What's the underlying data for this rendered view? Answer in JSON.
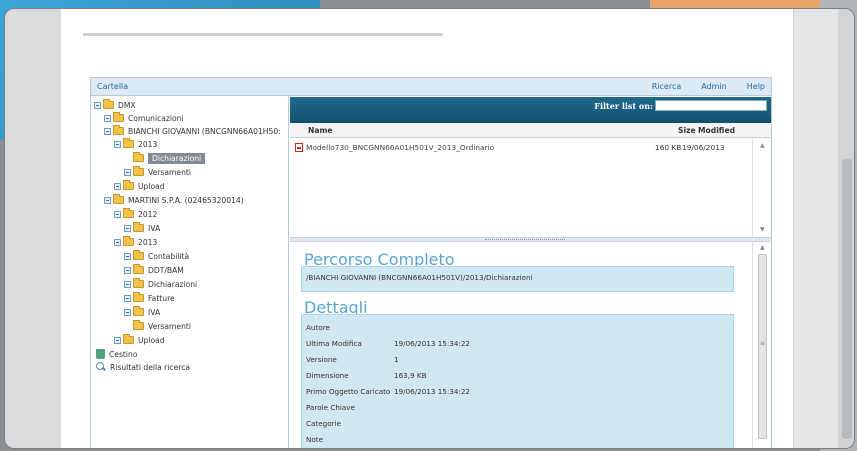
{
  "menubar": {
    "cartella": "Cartella",
    "links": [
      "Ricerca",
      "Admin",
      "Help"
    ]
  },
  "tree": {
    "root": "DMX",
    "comunicazioni": "Comunicazioni",
    "bianchi": "BIANCHI GIOVANNI (BNCGNN66A01H50:",
    "year_2013_a": "2013",
    "dichiarazioni_selected": "Dichiarazioni",
    "versamenti_a": "Versamenti",
    "upload_a": "Upload",
    "martini": "MARTINI S.P.A. (02465320014)",
    "year_2012": "2012",
    "iva_2012": "IVA",
    "year_2013_b": "2013",
    "contabilita": "Contabilità",
    "ddt": "DDT/BAM",
    "dichiarazioni_b": "Dichiarazioni",
    "fatture": "Fatture",
    "iva_2013": "IVA",
    "versamenti_b": "Versamenti",
    "upload_b": "Upload",
    "cestino": "Cestino",
    "risultati": "Risultati della ricerca"
  },
  "list": {
    "filter_label": "Filter list on:",
    "filter_value": "",
    "col_name": "Name",
    "col_size": "Size",
    "col_modified": "Modified",
    "rows": [
      {
        "name": "Modello730_BNCGNN66A01H501V_2013_Ordinario",
        "size": "160 KB",
        "modified": "19/06/2013"
      }
    ]
  },
  "details": {
    "percorso_title": "Percorso Completo",
    "path": "/BIANCHI GIOVANNI (BNCGNN66A01H501V)/2013/Dichiarazioni",
    "dettagli_title": "Dettagli",
    "props": [
      {
        "key": "Autore",
        "value": ""
      },
      {
        "key": "Ultima Modifica",
        "value": "19/06/2013 15:34:22"
      },
      {
        "key": "Versione",
        "value": "1"
      },
      {
        "key": "Dimensione",
        "value": "163,9 KB"
      },
      {
        "key": "Primo Oggetto Caricato",
        "value": "19/06/2013 15:34:22"
      },
      {
        "key": "Parole Chiave",
        "value": ""
      },
      {
        "key": "Categorie",
        "value": ""
      },
      {
        "key": "Note",
        "value": ""
      }
    ]
  },
  "colors": {
    "accent": "#2468a8",
    "header_dark": "#14506d",
    "detail_box": "#cfe8f3",
    "section_title": "#5aa6d0"
  }
}
